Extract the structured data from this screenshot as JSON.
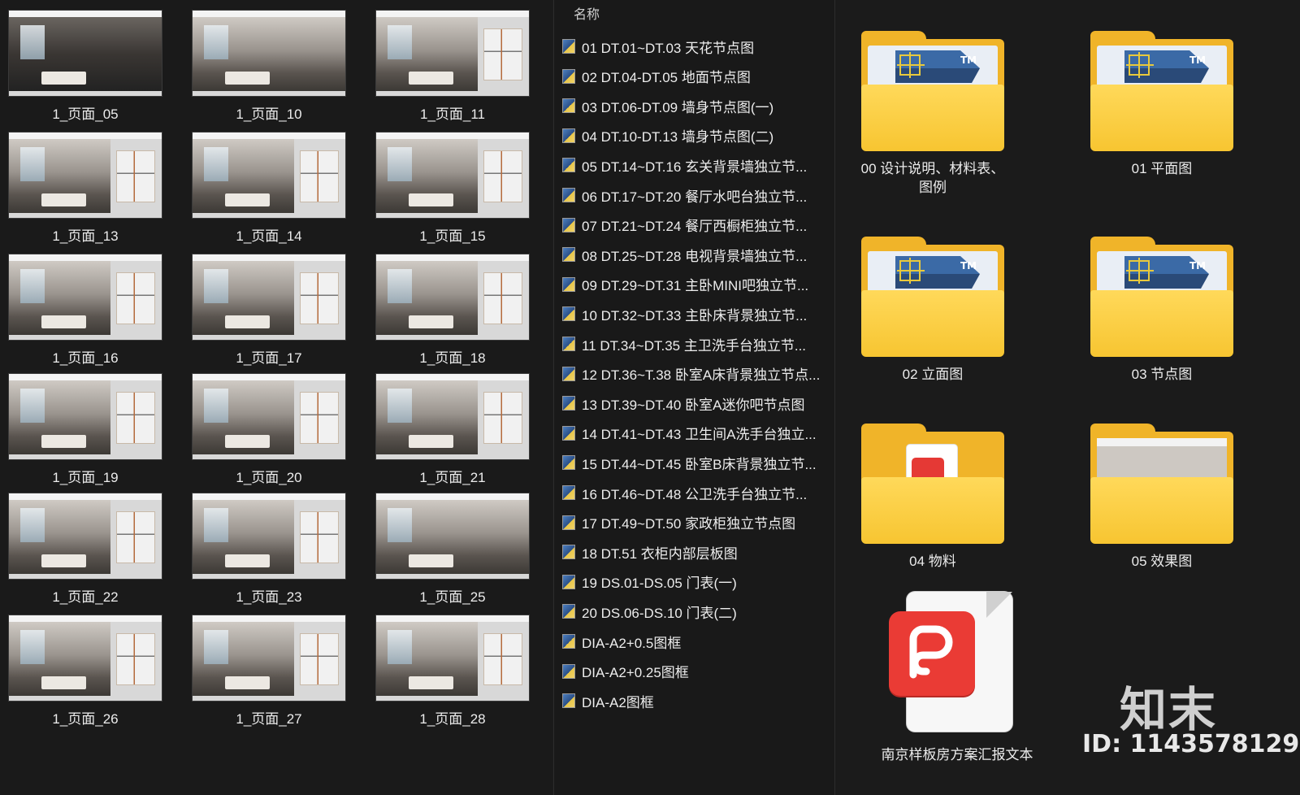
{
  "thumbnails": [
    {
      "label": "1_页面_05"
    },
    {
      "label": "1_页面_10"
    },
    {
      "label": "1_页面_11"
    },
    {
      "label": "1_页面_13"
    },
    {
      "label": "1_页面_14"
    },
    {
      "label": "1_页面_15"
    },
    {
      "label": "1_页面_16"
    },
    {
      "label": "1_页面_17"
    },
    {
      "label": "1_页面_18"
    },
    {
      "label": "1_页面_19"
    },
    {
      "label": "1_页面_20"
    },
    {
      "label": "1_页面_21"
    },
    {
      "label": "1_页面_22"
    },
    {
      "label": "1_页面_23"
    },
    {
      "label": "1_页面_25"
    },
    {
      "label": "1_页面_26"
    },
    {
      "label": "1_页面_27"
    },
    {
      "label": "1_页面_28"
    }
  ],
  "list": {
    "header": "名称",
    "sort_glyph": "^",
    "items": [
      "01 DT.01~DT.03 天花节点图",
      "02 DT.04-DT.05 地面节点图",
      "03 DT.06-DT.09 墙身节点图(一)",
      "04 DT.10-DT.13 墙身节点图(二)",
      "05 DT.14~DT.16 玄关背景墙独立节...",
      "06 DT.17~DT.20 餐厅水吧台独立节...",
      "07 DT.21~DT.24 餐厅西橱柜独立节...",
      "08 DT.25~DT.28 电视背景墙独立节...",
      "09 DT.29~DT.31 主卧MINI吧独立节...",
      "10 DT.32~DT.33 主卧床背景独立节...",
      "11 DT.34~DT.35 主卫洗手台独立节...",
      "12 DT.36~T.38 卧室A床背景独立节点...",
      "13 DT.39~DT.40 卧室A迷你吧节点图",
      "14 DT.41~DT.43 卫生间A洗手台独立...",
      "15 DT.44~DT.45 卧室B床背景独立节...",
      "16 DT.46~DT.48 公卫洗手台独立节...",
      "17 DT.49~DT.50 家政柜独立节点图",
      "18 DT.51 衣柜内部层板图",
      "19 DS.01-DS.05 门表(一)",
      "20 DS.06-DS.10 门表(二)",
      "DIA-A2+0.5图框",
      "DIA-A2+0.25图框",
      "DIA-A2图框"
    ]
  },
  "folders": [
    {
      "label_line1": "00  设计说明、材料表、",
      "label_line2": "图例",
      "icon": "cad-folder-icon"
    },
    {
      "label_line1": "01 平面图",
      "label_line2": "",
      "icon": "cad-folder-icon"
    },
    {
      "label_line1": "02 立面图",
      "label_line2": "",
      "icon": "cad-folder-icon"
    },
    {
      "label_line1": "03 节点图",
      "label_line2": "",
      "icon": "cad-folder-icon"
    },
    {
      "label_line1": "04 物料",
      "label_line2": "",
      "icon": "pdf-folder-icon"
    },
    {
      "label_line1": "05 效果图",
      "label_line2": "",
      "icon": "image-folder-icon"
    }
  ],
  "pdf_file": {
    "label": "南京样板房方案汇报文本"
  },
  "cad_tm": "TM",
  "watermark": {
    "logo": "知末",
    "id": "ID: 1143578129"
  }
}
